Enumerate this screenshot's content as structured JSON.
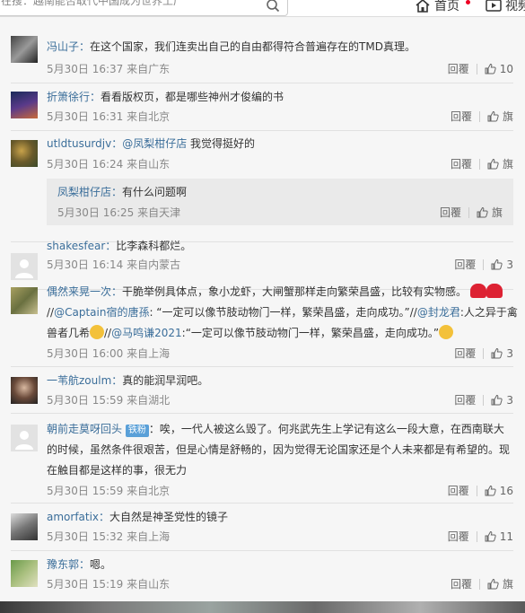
{
  "topbar": {
    "search_text": "在搜：越南能否取代中国成为世界工厂",
    "home_label": "首页",
    "video_label": "视频"
  },
  "labels": {
    "reply": "回覆",
    "report": "旗"
  },
  "comments": [
    {
      "user": "冯山子：",
      "text": "在这个国家，我们连卖出自己的自由都得符合普遍存在的TMD真理。",
      "meta": "5月30日 16:37 来自广东",
      "likes": "10"
    },
    {
      "user": "折箫徐行：",
      "text": "看看版权页，都是哪些神州才俊编的书",
      "meta": "5月30日 16:31 来自北京",
      "likes": ""
    },
    {
      "user": "utldtusurdjv：",
      "mention": "@凤梨柑仔店",
      "text": " 我觉得挺好的",
      "meta": "5月30日 16:24 来自山东",
      "likes": ""
    },
    {
      "user": "shakesfear：",
      "text": "比李森科都烂。",
      "meta": "5月30日 16:14 来自内蒙古",
      "likes": "3"
    },
    {
      "user": "偶然来晃一次：",
      "text1": "干脆举例具体点，象小龙虾，大闸蟹那样走向繁荣昌盛，比较有实物感。",
      "line2_a": "//",
      "mention1": "@Captain宿的唐孫",
      "line2_b": ": “一定可以像节肢动物门一样，繁荣昌盛，走向成功。”//",
      "mention2": "@封龙君",
      "line2_c": ":人之异于禽",
      "line3_a": "兽者几希",
      "line3_b": "//",
      "mention3": "@马鸣谦2021",
      "line3_c": ":“一定可以像节肢动物门一样，繁荣昌盛，走向成功。”",
      "meta": "5月30日 16:00 来自上海",
      "likes": "3"
    },
    {
      "user": "一苇航zoulm：",
      "text": "真的能润早润吧。",
      "meta": "5月30日 15:59 来自湖北",
      "likes": "3"
    },
    {
      "user": "朝前走莫呀回头",
      "badge": "铁粉",
      "line1": "：唉，一代人被这么毁了。何兆武先生上学记有这么一段大意，在西南联大",
      "line2": "的时候，虽然条件很艰苦，但是心情是舒畅的，因为觉得无论国家还是个人未来都是有希望的。现",
      "line3": "在触目都是这样的事，很无力",
      "meta": "5月30日 15:59 来自北京",
      "likes": "16"
    },
    {
      "user": "amorfatix：",
      "text": "大自然是神圣党性的镜子",
      "meta": "5月30日 15:32 来自上海",
      "likes": "11"
    },
    {
      "user": "豫东郭：",
      "text": "嗯。",
      "meta": "5月30日 15:19 来自山东",
      "likes": ""
    }
  ],
  "nested_reply": {
    "user": "凤梨柑仔店：",
    "text": "有什么问题啊",
    "meta": "5月30日 16:25 来自天津"
  }
}
